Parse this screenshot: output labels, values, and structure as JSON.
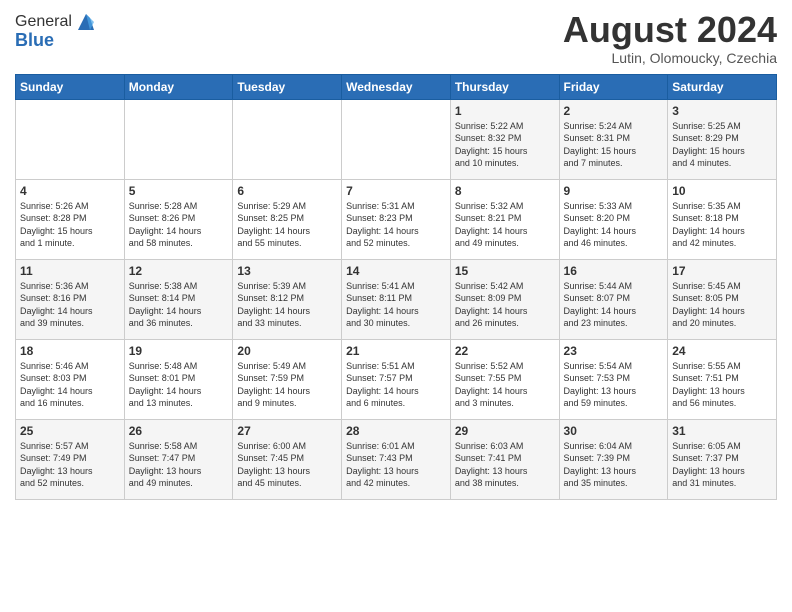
{
  "header": {
    "logo_line1": "General",
    "logo_line2": "Blue",
    "month": "August 2024",
    "location": "Lutin, Olomoucky, Czechia"
  },
  "weekdays": [
    "Sunday",
    "Monday",
    "Tuesday",
    "Wednesday",
    "Thursday",
    "Friday",
    "Saturday"
  ],
  "weeks": [
    [
      {
        "day": "",
        "info": ""
      },
      {
        "day": "",
        "info": ""
      },
      {
        "day": "",
        "info": ""
      },
      {
        "day": "",
        "info": ""
      },
      {
        "day": "1",
        "info": "Sunrise: 5:22 AM\nSunset: 8:32 PM\nDaylight: 15 hours\nand 10 minutes."
      },
      {
        "day": "2",
        "info": "Sunrise: 5:24 AM\nSunset: 8:31 PM\nDaylight: 15 hours\nand 7 minutes."
      },
      {
        "day": "3",
        "info": "Sunrise: 5:25 AM\nSunset: 8:29 PM\nDaylight: 15 hours\nand 4 minutes."
      }
    ],
    [
      {
        "day": "4",
        "info": "Sunrise: 5:26 AM\nSunset: 8:28 PM\nDaylight: 15 hours\nand 1 minute."
      },
      {
        "day": "5",
        "info": "Sunrise: 5:28 AM\nSunset: 8:26 PM\nDaylight: 14 hours\nand 58 minutes."
      },
      {
        "day": "6",
        "info": "Sunrise: 5:29 AM\nSunset: 8:25 PM\nDaylight: 14 hours\nand 55 minutes."
      },
      {
        "day": "7",
        "info": "Sunrise: 5:31 AM\nSunset: 8:23 PM\nDaylight: 14 hours\nand 52 minutes."
      },
      {
        "day": "8",
        "info": "Sunrise: 5:32 AM\nSunset: 8:21 PM\nDaylight: 14 hours\nand 49 minutes."
      },
      {
        "day": "9",
        "info": "Sunrise: 5:33 AM\nSunset: 8:20 PM\nDaylight: 14 hours\nand 46 minutes."
      },
      {
        "day": "10",
        "info": "Sunrise: 5:35 AM\nSunset: 8:18 PM\nDaylight: 14 hours\nand 42 minutes."
      }
    ],
    [
      {
        "day": "11",
        "info": "Sunrise: 5:36 AM\nSunset: 8:16 PM\nDaylight: 14 hours\nand 39 minutes."
      },
      {
        "day": "12",
        "info": "Sunrise: 5:38 AM\nSunset: 8:14 PM\nDaylight: 14 hours\nand 36 minutes."
      },
      {
        "day": "13",
        "info": "Sunrise: 5:39 AM\nSunset: 8:12 PM\nDaylight: 14 hours\nand 33 minutes."
      },
      {
        "day": "14",
        "info": "Sunrise: 5:41 AM\nSunset: 8:11 PM\nDaylight: 14 hours\nand 30 minutes."
      },
      {
        "day": "15",
        "info": "Sunrise: 5:42 AM\nSunset: 8:09 PM\nDaylight: 14 hours\nand 26 minutes."
      },
      {
        "day": "16",
        "info": "Sunrise: 5:44 AM\nSunset: 8:07 PM\nDaylight: 14 hours\nand 23 minutes."
      },
      {
        "day": "17",
        "info": "Sunrise: 5:45 AM\nSunset: 8:05 PM\nDaylight: 14 hours\nand 20 minutes."
      }
    ],
    [
      {
        "day": "18",
        "info": "Sunrise: 5:46 AM\nSunset: 8:03 PM\nDaylight: 14 hours\nand 16 minutes."
      },
      {
        "day": "19",
        "info": "Sunrise: 5:48 AM\nSunset: 8:01 PM\nDaylight: 14 hours\nand 13 minutes."
      },
      {
        "day": "20",
        "info": "Sunrise: 5:49 AM\nSunset: 7:59 PM\nDaylight: 14 hours\nand 9 minutes."
      },
      {
        "day": "21",
        "info": "Sunrise: 5:51 AM\nSunset: 7:57 PM\nDaylight: 14 hours\nand 6 minutes."
      },
      {
        "day": "22",
        "info": "Sunrise: 5:52 AM\nSunset: 7:55 PM\nDaylight: 14 hours\nand 3 minutes."
      },
      {
        "day": "23",
        "info": "Sunrise: 5:54 AM\nSunset: 7:53 PM\nDaylight: 13 hours\nand 59 minutes."
      },
      {
        "day": "24",
        "info": "Sunrise: 5:55 AM\nSunset: 7:51 PM\nDaylight: 13 hours\nand 56 minutes."
      }
    ],
    [
      {
        "day": "25",
        "info": "Sunrise: 5:57 AM\nSunset: 7:49 PM\nDaylight: 13 hours\nand 52 minutes."
      },
      {
        "day": "26",
        "info": "Sunrise: 5:58 AM\nSunset: 7:47 PM\nDaylight: 13 hours\nand 49 minutes."
      },
      {
        "day": "27",
        "info": "Sunrise: 6:00 AM\nSunset: 7:45 PM\nDaylight: 13 hours\nand 45 minutes."
      },
      {
        "day": "28",
        "info": "Sunrise: 6:01 AM\nSunset: 7:43 PM\nDaylight: 13 hours\nand 42 minutes."
      },
      {
        "day": "29",
        "info": "Sunrise: 6:03 AM\nSunset: 7:41 PM\nDaylight: 13 hours\nand 38 minutes."
      },
      {
        "day": "30",
        "info": "Sunrise: 6:04 AM\nSunset: 7:39 PM\nDaylight: 13 hours\nand 35 minutes."
      },
      {
        "day": "31",
        "info": "Sunrise: 6:05 AM\nSunset: 7:37 PM\nDaylight: 13 hours\nand 31 minutes."
      }
    ]
  ]
}
